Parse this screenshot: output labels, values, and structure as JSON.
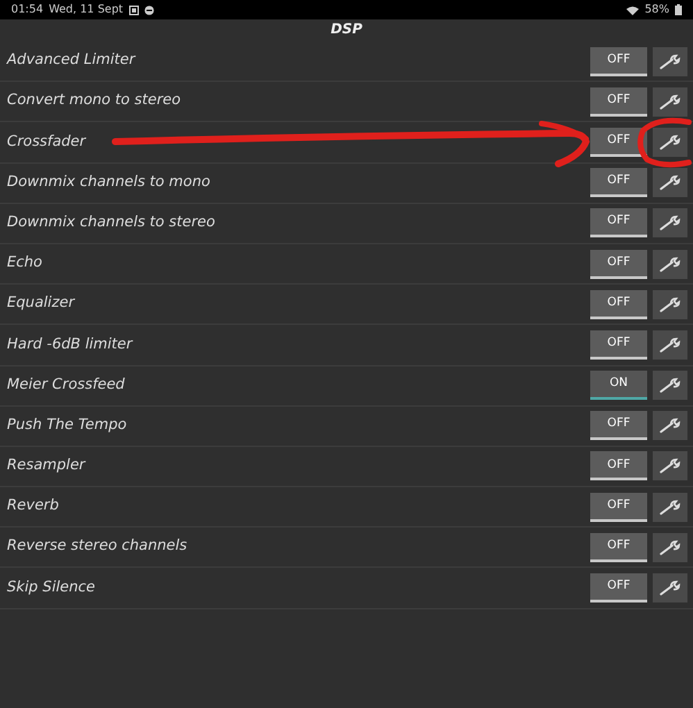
{
  "status_bar": {
    "time": "01:54",
    "date": "Wed, 11 Sept",
    "battery": "58%"
  },
  "title": "DSP",
  "effects": [
    {
      "name": "Advanced Limiter",
      "toggle": "OFF",
      "on": false
    },
    {
      "name": "Convert mono to stereo",
      "toggle": "OFF",
      "on": false
    },
    {
      "name": "Crossfader",
      "toggle": "OFF",
      "on": false
    },
    {
      "name": "Downmix channels to mono",
      "toggle": "OFF",
      "on": false
    },
    {
      "name": "Downmix channels to stereo",
      "toggle": "OFF",
      "on": false
    },
    {
      "name": "Echo",
      "toggle": "OFF",
      "on": false
    },
    {
      "name": "Equalizer",
      "toggle": "OFF",
      "on": false
    },
    {
      "name": "Hard -6dB limiter",
      "toggle": "OFF",
      "on": false
    },
    {
      "name": "Meier Crossfeed",
      "toggle": "ON",
      "on": true
    },
    {
      "name": "Push The Tempo",
      "toggle": "OFF",
      "on": false
    },
    {
      "name": "Resampler",
      "toggle": "OFF",
      "on": false
    },
    {
      "name": "Reverb",
      "toggle": "OFF",
      "on": false
    },
    {
      "name": "Reverse stereo channels",
      "toggle": "OFF",
      "on": false
    },
    {
      "name": "Skip Silence",
      "toggle": "OFF",
      "on": false
    }
  ],
  "annotations": [
    {
      "kind": "arrow"
    },
    {
      "kind": "circle"
    }
  ]
}
